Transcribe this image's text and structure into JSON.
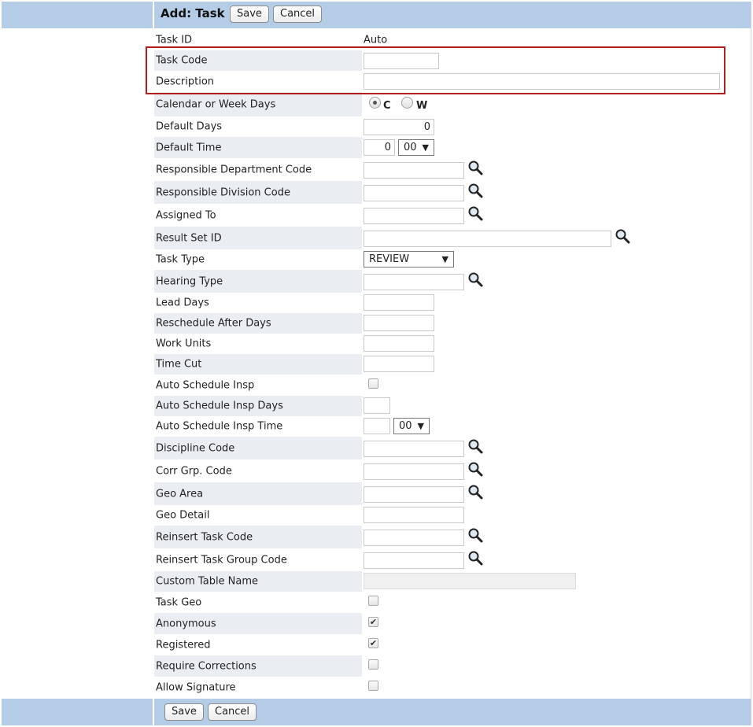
{
  "header": {
    "title": "Add: Task",
    "save_label": "Save",
    "cancel_label": "Cancel"
  },
  "footer": {
    "save_label": "Save",
    "cancel_label": "Cancel"
  },
  "fields": {
    "task_id": {
      "label": "Task ID",
      "value": "Auto"
    },
    "task_code": {
      "label": "Task Code",
      "value": ""
    },
    "description": {
      "label": "Description",
      "value": ""
    },
    "calendar_or_week_days": {
      "label": "Calendar or Week Days",
      "options": [
        "C",
        "W"
      ],
      "selected": "C"
    },
    "default_days": {
      "label": "Default Days",
      "value": "0"
    },
    "default_time": {
      "label": "Default Time",
      "hour": "0",
      "minute": "00"
    },
    "responsible_department_code": {
      "label": "Responsible Department Code",
      "value": ""
    },
    "responsible_division_code": {
      "label": "Responsible Division Code",
      "value": ""
    },
    "assigned_to": {
      "label": "Assigned To",
      "value": ""
    },
    "result_set_id": {
      "label": "Result Set ID",
      "value": ""
    },
    "task_type": {
      "label": "Task Type",
      "value": "REVIEW"
    },
    "hearing_type": {
      "label": "Hearing Type",
      "value": ""
    },
    "lead_days": {
      "label": "Lead Days",
      "value": ""
    },
    "reschedule_after_days": {
      "label": "Reschedule After Days",
      "value": ""
    },
    "work_units": {
      "label": "Work Units",
      "value": ""
    },
    "time_cut": {
      "label": "Time Cut",
      "value": ""
    },
    "auto_schedule_insp": {
      "label": "Auto Schedule Insp",
      "checked": false
    },
    "auto_schedule_insp_days": {
      "label": "Auto Schedule Insp Days",
      "value": ""
    },
    "auto_schedule_insp_time": {
      "label": "Auto Schedule Insp Time",
      "hour": "",
      "minute": "00"
    },
    "discipline_code": {
      "label": "Discipline Code",
      "value": ""
    },
    "corr_grp_code": {
      "label": "Corr Grp. Code",
      "value": ""
    },
    "geo_area": {
      "label": "Geo Area",
      "value": ""
    },
    "geo_detail": {
      "label": "Geo Detail",
      "value": ""
    },
    "reinsert_task_code": {
      "label": "Reinsert Task Code",
      "value": ""
    },
    "reinsert_task_group_code": {
      "label": "Reinsert Task Group Code",
      "value": ""
    },
    "custom_table_name": {
      "label": "Custom Table Name",
      "value": ""
    },
    "task_geo": {
      "label": "Task Geo",
      "checked": false
    },
    "anonymous": {
      "label": "Anonymous",
      "checked": true
    },
    "registered": {
      "label": "Registered",
      "checked": true
    },
    "require_corrections": {
      "label": "Require Corrections",
      "checked": false
    },
    "allow_signature": {
      "label": "Allow Signature",
      "checked": false
    }
  },
  "icons": {
    "lookup": "magnifier-icon",
    "check": "checkmark-icon",
    "dropdown": "triangle-down-icon"
  },
  "colors": {
    "header_bar": "#b5cce6",
    "row_shade": "#eaeef3",
    "highlight_border": "#b01e1e"
  }
}
